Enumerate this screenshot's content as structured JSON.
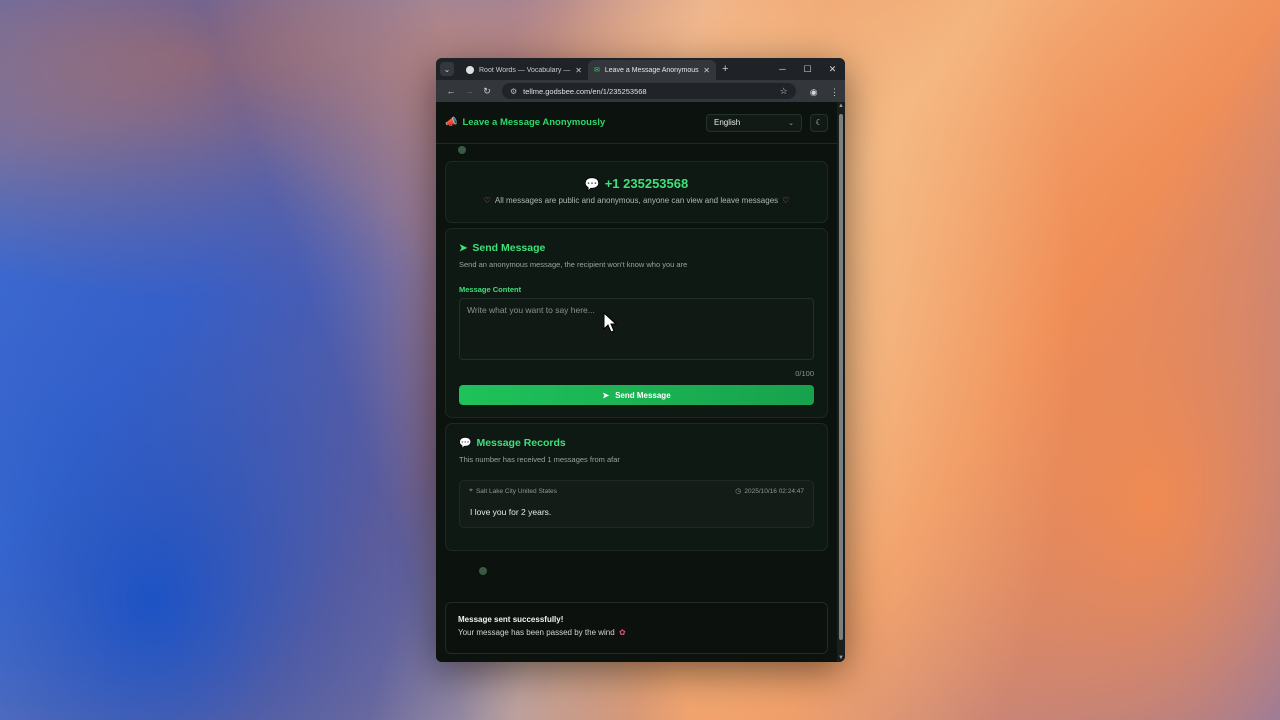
{
  "browser": {
    "tabs": [
      {
        "title": "Root Words — Vocabulary —",
        "active": false
      },
      {
        "title": "Leave a Message Anonymously",
        "active": true
      }
    ],
    "url": "tellme.godsbee.com/en/1/235253568"
  },
  "header": {
    "brand": "Leave a Message Anonymously",
    "language": "English"
  },
  "hero": {
    "phone": "+1 235253568",
    "note": "All messages are public and anonymous, anyone can view and leave messages"
  },
  "send": {
    "title": "Send Message",
    "subtitle": "Send an anonymous message, the recipient won't know who you are",
    "field_label": "Message Content",
    "placeholder": "Write what you want to say here...",
    "char_count": "0/100",
    "button_label": "Send Message"
  },
  "records": {
    "title": "Message Records",
    "subtitle": "This number has received 1 messages from afar",
    "items": [
      {
        "location": "Salt Lake City United States",
        "time": "2025/10/16 02:24:47",
        "text": "I love you for 2 years."
      }
    ]
  },
  "toast": {
    "title": "Message sent successfully!",
    "text": "Your message has been passed by the wind"
  },
  "colors": {
    "accent": "#3ee07a",
    "background": "#0c120e",
    "heart": "#ef5b76"
  }
}
